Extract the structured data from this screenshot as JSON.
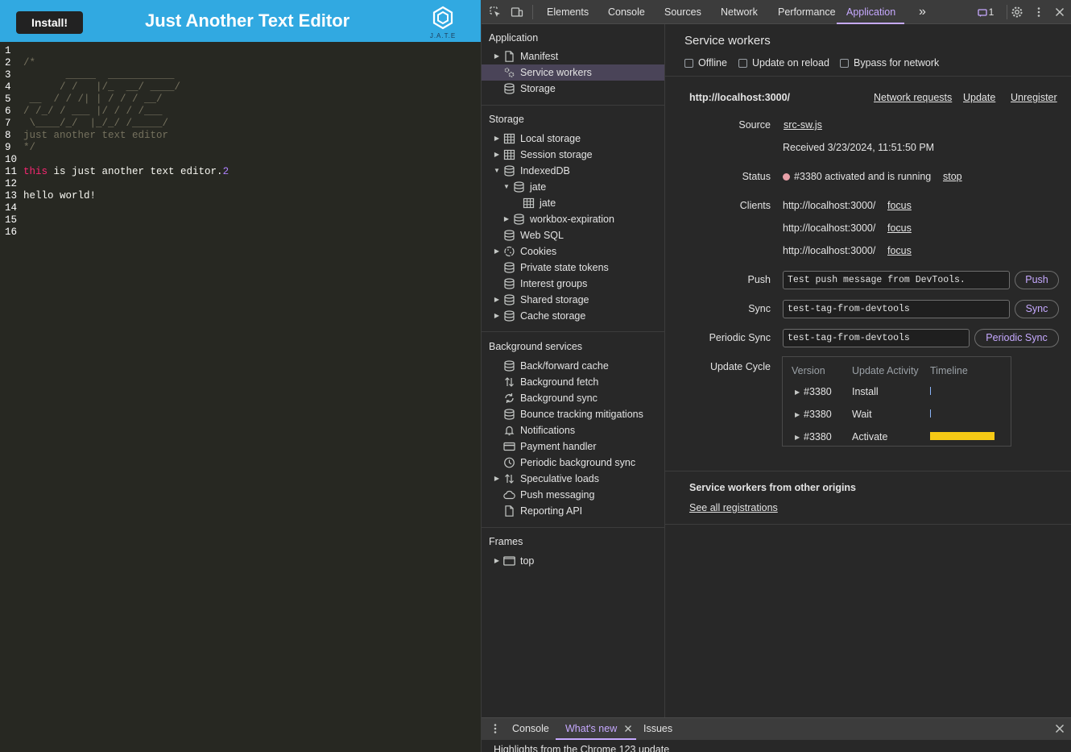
{
  "app": {
    "install_label": "Install!",
    "title": "Just Another Text Editor",
    "logo_text": "J.A.T.E",
    "editor_lines": [
      {
        "num": "1",
        "segments": []
      },
      {
        "num": "2",
        "segments": [
          {
            "text": "/*",
            "cls": "c-comment"
          }
        ]
      },
      {
        "num": "3",
        "segments": [
          {
            "text": "       _____  ___________",
            "cls": "c-comment"
          }
        ]
      },
      {
        "num": "4",
        "segments": [
          {
            "text": "      / /   |/_  __/ ____/",
            "cls": "c-comment"
          }
        ]
      },
      {
        "num": "5",
        "segments": [
          {
            "text": " __  / / /| | / / / __/",
            "cls": "c-comment"
          }
        ]
      },
      {
        "num": "6",
        "segments": [
          {
            "text": "/ /_/ / ___ |/ / / /___",
            "cls": "c-comment"
          }
        ]
      },
      {
        "num": "7",
        "segments": [
          {
            "text": " \\____/_/  |_/_/ /_____/",
            "cls": "c-comment"
          }
        ]
      },
      {
        "num": "8",
        "segments": [
          {
            "text": "just another text editor",
            "cls": "c-comment"
          }
        ]
      },
      {
        "num": "9",
        "segments": [
          {
            "text": "*/",
            "cls": "c-comment"
          }
        ]
      },
      {
        "num": "10",
        "segments": []
      },
      {
        "num": "11",
        "segments": [
          {
            "text": "this",
            "cls": "c-kw"
          },
          {
            "text": " is just another text editor.",
            "cls": ""
          },
          {
            "text": "2",
            "cls": "c-num"
          }
        ]
      },
      {
        "num": "12",
        "segments": []
      },
      {
        "num": "13",
        "segments": [
          {
            "text": "hello world!",
            "cls": ""
          }
        ]
      },
      {
        "num": "14",
        "segments": []
      },
      {
        "num": "15",
        "segments": []
      },
      {
        "num": "16",
        "segments": []
      }
    ]
  },
  "devtools": {
    "toolbar": {
      "tabs": [
        "Elements",
        "Console",
        "Sources",
        "Network",
        "Performance",
        "Application"
      ],
      "active_tab": "Application",
      "more_label": "»",
      "issues_count": "1"
    },
    "sidebar": {
      "application_heading": "Application",
      "application_items": [
        "Manifest",
        "Service workers",
        "Storage"
      ],
      "storage_heading": "Storage",
      "storage_items": [
        "Local storage",
        "Session storage",
        "IndexedDB",
        "jate",
        "jate",
        "workbox-expiration",
        "Web SQL",
        "Cookies",
        "Private state tokens",
        "Interest groups",
        "Shared storage",
        "Cache storage"
      ],
      "background_heading": "Background services",
      "background_items": [
        "Back/forward cache",
        "Background fetch",
        "Background sync",
        "Bounce tracking mitigations",
        "Notifications",
        "Payment handler",
        "Periodic background sync",
        "Speculative loads",
        "Push messaging",
        "Reporting API"
      ],
      "frames_heading": "Frames",
      "frames_items": [
        "top"
      ]
    },
    "main": {
      "title": "Service workers",
      "checkboxes": [
        "Offline",
        "Update on reload",
        "Bypass for network"
      ],
      "origin": "http://localhost:3000/",
      "links": {
        "network_requests": "Network requests",
        "update": "Update",
        "unregister": "Unregister"
      },
      "source_label": "Source",
      "source_file": "src-sw.js",
      "received": "Received 3/23/2024, 11:51:50 PM",
      "status_label": "Status",
      "status_text": "#3380 activated and is running",
      "status_stop": "stop",
      "status_dot_color": "#e8a0a8",
      "clients_label": "Clients",
      "clients": [
        {
          "url": "http://localhost:3000/",
          "action": "focus"
        },
        {
          "url": "http://localhost:3000/",
          "action": "focus"
        },
        {
          "url": "http://localhost:3000/",
          "action": "focus"
        }
      ],
      "push_label": "Push",
      "push_value": "Test push message from DevTools.",
      "push_button": "Push",
      "sync_label": "Sync",
      "sync_value": "test-tag-from-devtools",
      "sync_button": "Sync",
      "periodic_label": "Periodic Sync",
      "periodic_value": "test-tag-from-devtools",
      "periodic_button": "Periodic Sync",
      "update_cycle_label": "Update Cycle",
      "update_cycle": {
        "headers": [
          "Version",
          "Update Activity",
          "Timeline"
        ],
        "rows": [
          {
            "version": "#3380",
            "activity": "Install",
            "timeline_fraction": 0.0
          },
          {
            "version": "#3380",
            "activity": "Wait",
            "timeline_fraction": 0.0
          },
          {
            "version": "#3380",
            "activity": "Activate",
            "timeline_fraction": 1.0
          }
        ],
        "activate_color": "#f6c915",
        "tick_color": "#8ab4f8"
      },
      "other_origins_title": "Service workers from other origins",
      "see_all": "See all registrations"
    },
    "drawer": {
      "tabs": [
        "Console",
        "What's new",
        "Issues"
      ],
      "active_tab": "What's new",
      "content": "Highlights from the Chrome 123 update"
    }
  }
}
